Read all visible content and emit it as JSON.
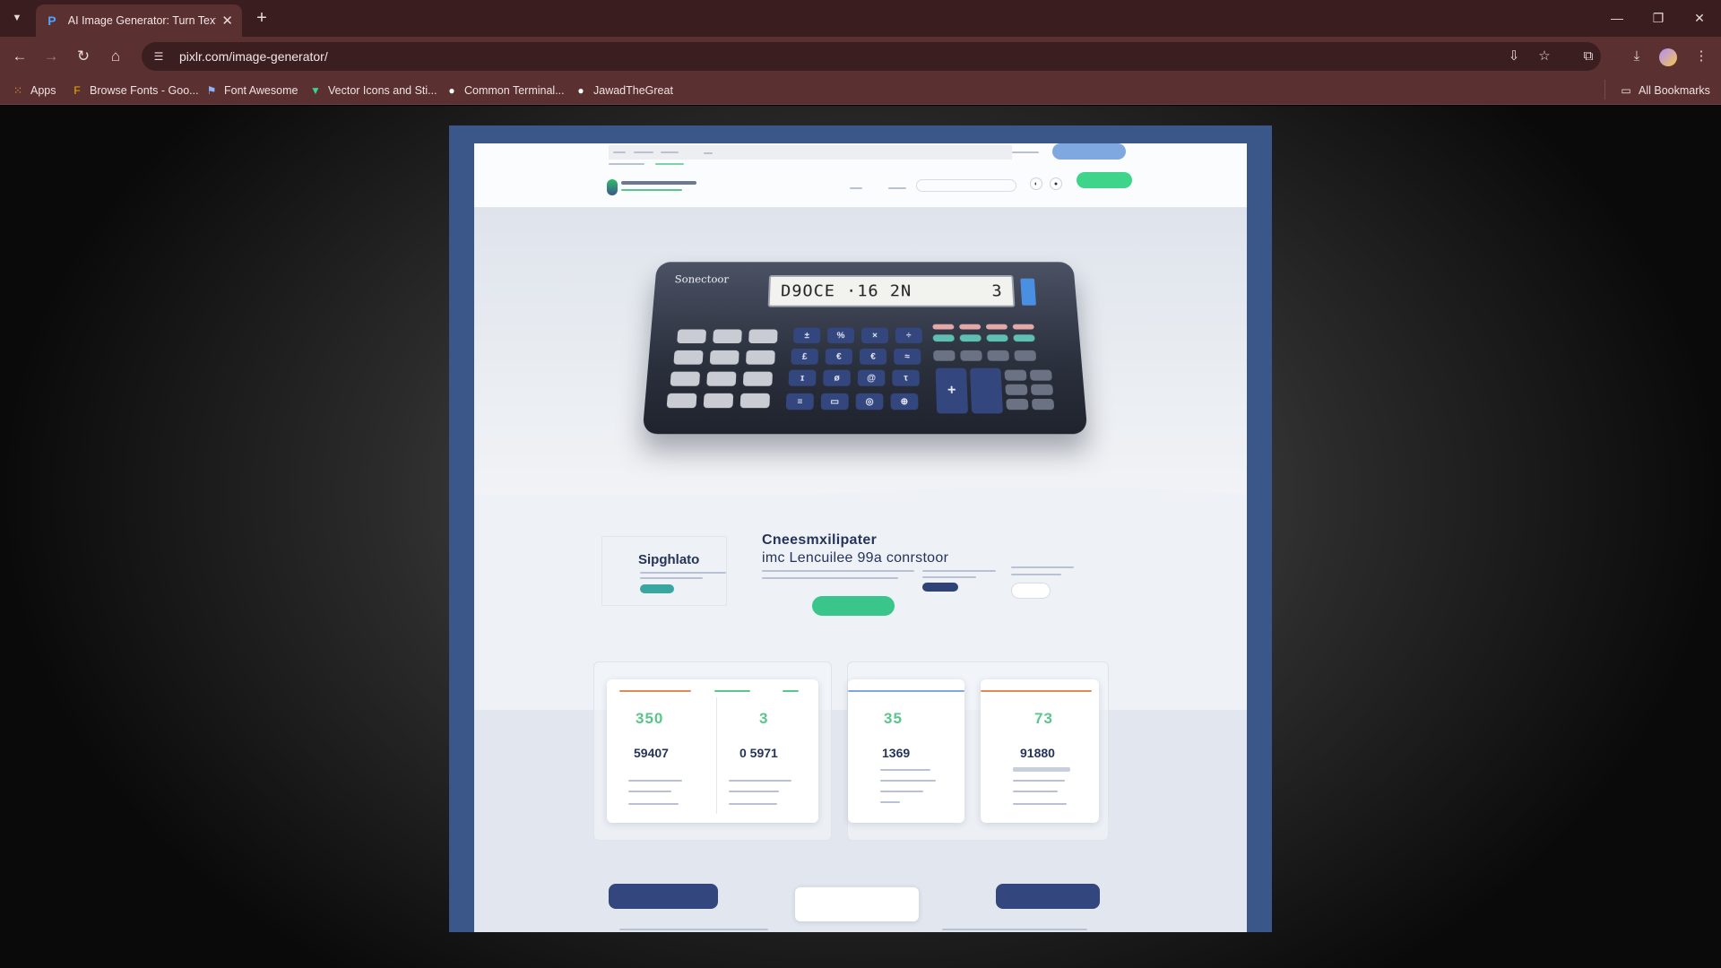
{
  "browser": {
    "tab_title": "AI Image Generator: Turn Text t",
    "url": "pixlr.com/image-generator/",
    "bookmarks": [
      {
        "label": "Apps",
        "icon": "apps-grid-icon"
      },
      {
        "label": "Browse Fonts - Goo...",
        "icon": "google-fonts-icon"
      },
      {
        "label": "Font Awesome",
        "icon": "flag-icon"
      },
      {
        "label": "Vector Icons and Sti...",
        "icon": "vector-icon"
      },
      {
        "label": "Common Terminal...",
        "icon": "github-icon"
      },
      {
        "label": "JawadTheGreat",
        "icon": "github-icon"
      }
    ],
    "all_bookmarks": "All Bookmarks",
    "colors": {
      "chrome": "#5a3031",
      "tabbar": "#3a1e1f"
    }
  },
  "generated_image": {
    "calculator": {
      "brand": "Sonectoor",
      "display": "D9OCE ·16 2N",
      "display_right": "3"
    },
    "promo": {
      "side_title": "Sipghlato",
      "title_line1": "Cneesmxilipater",
      "title_line2": "imc Lencuilee  99a conrstoor"
    },
    "stats": [
      {
        "top": "350",
        "main": "59407"
      },
      {
        "top": "3",
        "main": "0 5971"
      },
      {
        "top": "35",
        "main": "1369"
      },
      {
        "top": "73",
        "main": "91880"
      }
    ],
    "colors": {
      "navy": "#34467e",
      "green": "#3ac68a",
      "frame": "#3b5689"
    }
  }
}
